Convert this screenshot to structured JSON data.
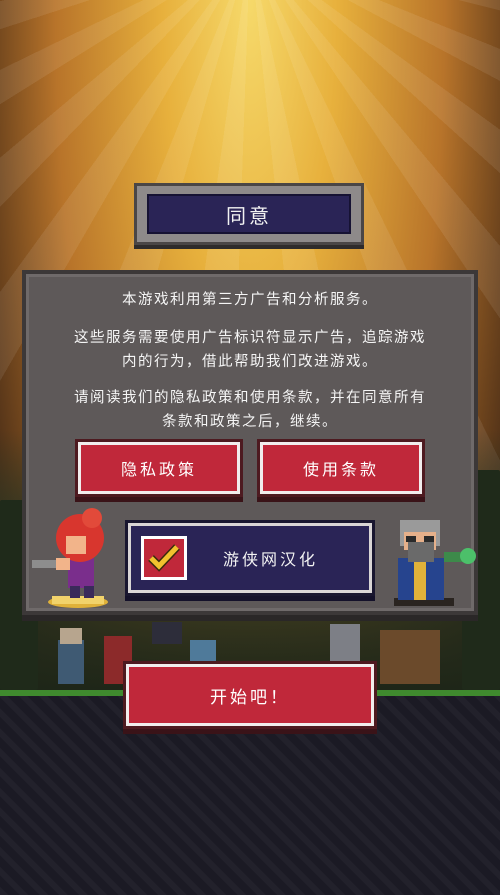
{
  "header": {
    "title": "同意"
  },
  "notice": {
    "line1": "本游戏利用第三方广告和分析服务。",
    "line2a": "这些服务需要使用广告标识符显示广告，追踪游戏",
    "line2b": "内的行为，借此帮助我们改进游戏。",
    "line3a": "请阅读我们的隐私政策和使用条款，并在同意所有",
    "line3b": "条款和政策之后，继续。"
  },
  "buttons": {
    "privacy": "隐私政策",
    "terms": "使用条款",
    "start": "开始吧！"
  },
  "localization": {
    "label": "游侠网汉化",
    "checked": true
  },
  "colors": {
    "accent_red": "#c0283a",
    "panel_gray": "#5e5959",
    "title_purple": "#2a2456",
    "checkmark_gold": "#f2c12e"
  },
  "icons": {
    "check": "checkmark-icon",
    "left_character": "red-haired-gunner-sprite",
    "right_character": "bearded-wizard-sprite"
  }
}
